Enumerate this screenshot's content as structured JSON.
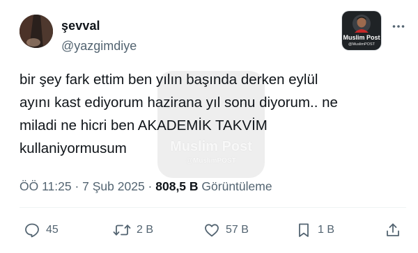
{
  "author": {
    "display_name": "şevval",
    "handle": "@yazgimdiye"
  },
  "watermark": {
    "title": "Muslim Post",
    "subtitle": "@MuslimPOST"
  },
  "tweet": {
    "lines": [
      "bir şey fark ettim ben yılın başında derken eylül",
      "ayını kast ediyorum hazirana yıl sonu diyorum.. ne",
      "miladi ne hicri ben AKADEMİK TAKVİM",
      "kullaniyormusum"
    ]
  },
  "meta": {
    "time": "ÖÖ 11:25",
    "separator": " · ",
    "date": "7 Şub 2025",
    "views_count": "808,5 B",
    "views_label": "Görüntüleme"
  },
  "actions": {
    "replies": "45",
    "reposts": "2 B",
    "likes": "57 B",
    "bookmarks": "1 B"
  },
  "icons": {
    "more": "more-horizontal-icon",
    "reply": "reply-bubble-icon",
    "repost": "repost-icon",
    "like": "heart-icon",
    "bookmark": "bookmark-icon",
    "share": "share-upload-icon"
  },
  "colors": {
    "text_primary": "#0f1419",
    "text_secondary": "#536471",
    "divider": "#eff3f4"
  }
}
